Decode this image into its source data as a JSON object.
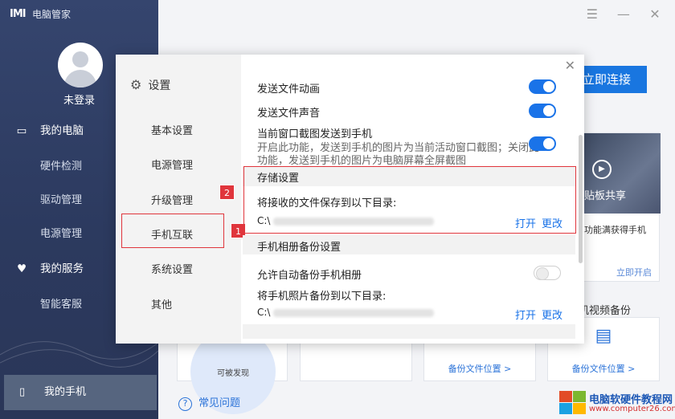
{
  "app": {
    "logo_text": "IMI",
    "name": "电脑管家"
  },
  "user": {
    "login_label": "未登录"
  },
  "sidebar": {
    "items": [
      {
        "label": "我的电脑",
        "icon": "laptop-icon"
      },
      {
        "label": "硬件检测"
      },
      {
        "label": "驱动管理"
      },
      {
        "label": "电源管理"
      },
      {
        "label": "我的服务",
        "icon": "heart-icon"
      },
      {
        "label": "智能客服"
      }
    ],
    "phone": {
      "label": "我的手机",
      "icon": "phone-icon"
    }
  },
  "main": {
    "connect_label": "立即连接",
    "clipboard_card": {
      "title": "贴板共享",
      "desc": "功能满获得手机",
      "link": "立即开启"
    },
    "bottom_cards": [
      {
        "caption": "可被发现"
      },
      {
        "link": ""
      },
      {
        "link": "备份文件位置 >"
      },
      {
        "title": "机视频备份",
        "link": "备份文件位置 >"
      }
    ],
    "faq_label": "常见问题"
  },
  "settings": {
    "title": "设置",
    "menu": [
      "基本设置",
      "电源管理",
      "升级管理",
      "手机互联",
      "系统设置",
      "其他"
    ],
    "selected_menu": "手机互联",
    "rows": [
      {
        "label": "发送文件动画",
        "on": true
      },
      {
        "label": "发送文件声音",
        "on": true
      },
      {
        "label": "当前窗口截图发送到手机",
        "on": true,
        "desc_line1": "开启此功能，发送到手机的图片为当前活动窗口截图；关闭此",
        "desc_line2": "功能，发送到手机的图片为电脑屏幕全屏截图"
      }
    ],
    "storage": {
      "title": "存储设置",
      "desc": "将接收的文件保存到以下目录:",
      "path_prefix": "C:\\",
      "open_label": "打开",
      "change_label": "更改"
    },
    "album": {
      "title": "手机相册备份设置",
      "allow_label": "允许自动备份手机相册",
      "allow_on": false,
      "desc": "将手机照片备份到以下目录:",
      "path_prefix": "C:\\",
      "open_label": "打开",
      "change_label": "更改"
    },
    "annotations": {
      "badge1": "1",
      "badge2": "2"
    }
  },
  "watermark": {
    "line1": "电脑软硬件教程网",
    "line2": "www.computer26.com"
  },
  "colors": {
    "sidebar": "#2f3d63",
    "accent": "#1a73e8",
    "highlight": "#e0353c"
  }
}
